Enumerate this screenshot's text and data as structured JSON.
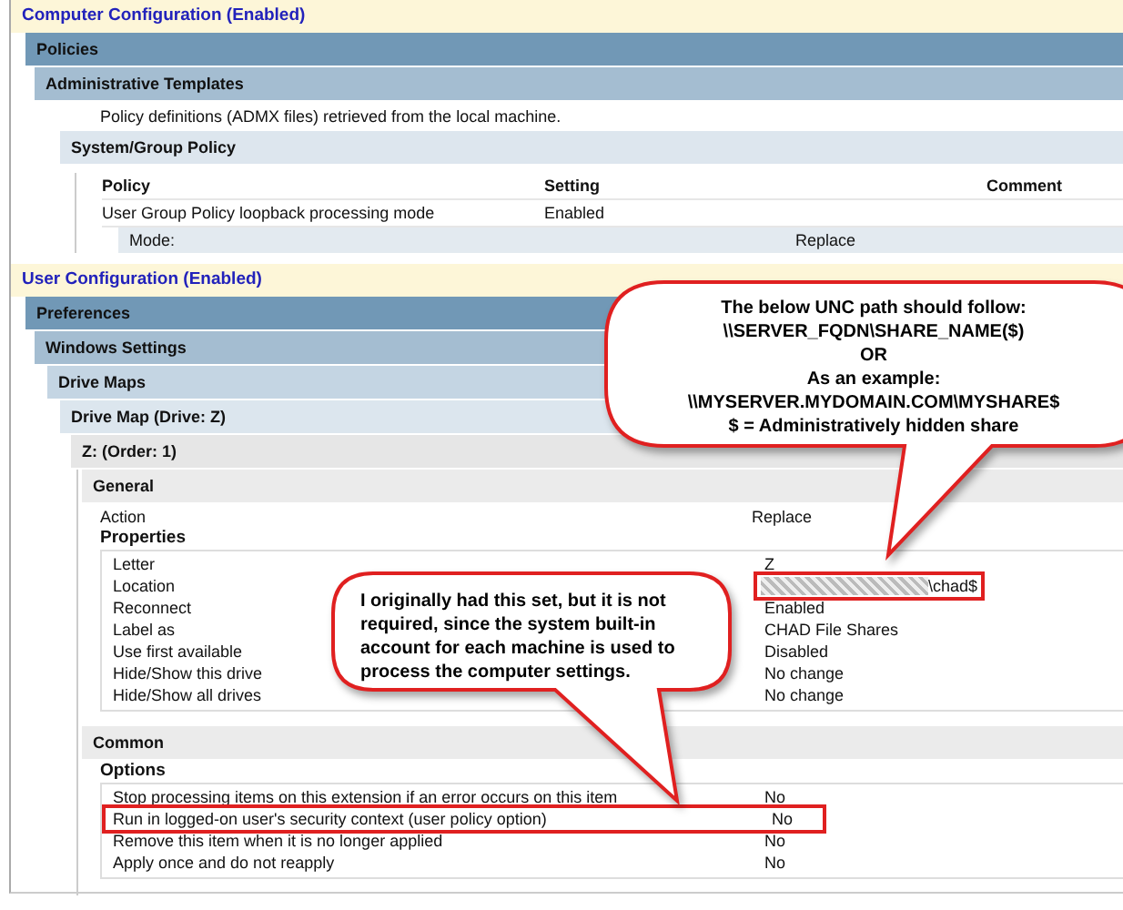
{
  "computer_configuration": {
    "title": "Computer Configuration (Enabled)",
    "policies": {
      "title": "Policies",
      "admin_templates": {
        "title": "Administrative Templates",
        "note": "Policy definitions (ADMX files) retrieved from the local machine.",
        "system_group_policy": {
          "title": "System/Group Policy",
          "columns": [
            "Policy",
            "Setting",
            "Comment"
          ],
          "rows": [
            {
              "policy": "User Group Policy loopback processing mode",
              "setting": "Enabled",
              "detail": {
                "label": "Mode:",
                "value": "Replace"
              }
            }
          ]
        }
      }
    }
  },
  "user_configuration": {
    "title": "User Configuration (Enabled)",
    "preferences": {
      "title": "Preferences",
      "windows_settings": {
        "title": "Windows Settings",
        "drive_maps": {
          "title": "Drive Maps",
          "drive_map": {
            "title": "Drive Map (Drive: Z)",
            "item": {
              "title": "Z: (Order: 1)",
              "general": {
                "title": "General",
                "action": {
                  "label": "Action",
                  "value": "Replace"
                },
                "properties": {
                  "title": "Properties",
                  "rows": [
                    {
                      "label": "Letter",
                      "value": "Z",
                      "highlighted": false,
                      "redacted": false
                    },
                    {
                      "label": "Location",
                      "value": "\\chad$",
                      "highlighted": true,
                      "redacted": true
                    },
                    {
                      "label": "Reconnect",
                      "value": "Enabled",
                      "highlighted": false,
                      "redacted": false
                    },
                    {
                      "label": "Label as",
                      "value": "CHAD File Shares",
                      "highlighted": false,
                      "redacted": false
                    },
                    {
                      "label": "Use first available",
                      "value": "Disabled",
                      "highlighted": false,
                      "redacted": false
                    },
                    {
                      "label": "Hide/Show this drive",
                      "value": "No change",
                      "highlighted": false,
                      "redacted": false
                    },
                    {
                      "label": "Hide/Show all drives",
                      "value": "No change",
                      "highlighted": false,
                      "redacted": false
                    }
                  ]
                }
              },
              "common": {
                "title": "Common",
                "options": {
                  "title": "Options",
                  "rows": [
                    {
                      "label": "Stop processing items on this extension if an error occurs on this item",
                      "value": "No",
                      "highlighted": false
                    },
                    {
                      "label": "Run in logged-on user's security context (user policy option)",
                      "value": "No",
                      "highlighted": true
                    },
                    {
                      "label": "Remove this item when it is no longer applied",
                      "value": "No",
                      "highlighted": false
                    },
                    {
                      "label": "Apply once and do not reapply",
                      "value": "No",
                      "highlighted": false
                    }
                  ]
                }
              }
            }
          }
        }
      }
    }
  },
  "callouts": [
    {
      "kind": "centered",
      "lines": [
        "The below UNC path should follow:",
        "\\\\SERVER_FQDN\\SHARE_NAME($)",
        "OR",
        "As an example:",
        "\\\\MYSERVER.MYDOMAIN.COM\\MYSHARE$",
        "$ = Administratively hidden share"
      ]
    },
    {
      "kind": "left",
      "lines": [
        "I originally had this set, but it is not",
        "required, since the system built-in",
        "account for each machine is used to",
        "process the computer settings."
      ]
    }
  ]
}
